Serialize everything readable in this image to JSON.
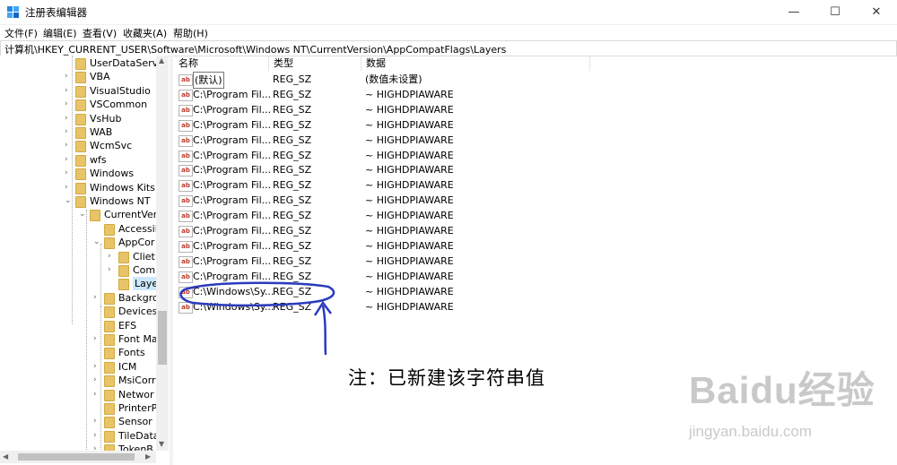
{
  "window": {
    "title": "注册表编辑器",
    "min_glyph": "—",
    "max_glyph": "☐",
    "close_glyph": "✕"
  },
  "menu": [
    "文件(F)",
    "编辑(E)",
    "查看(V)",
    "收藏夹(A)",
    "帮助(H)"
  ],
  "address": "计算机\\HKEY_CURRENT_USER\\Software\\Microsoft\\Windows NT\\CurrentVersion\\AppCompatFlags\\Layers",
  "tree": [
    {
      "label": "UserDataServi"
    },
    {
      "label": "VBA"
    },
    {
      "label": "VisualStudio"
    },
    {
      "label": "VSCommon"
    },
    {
      "label": "VsHub"
    },
    {
      "label": "WAB"
    },
    {
      "label": "WcmSvc"
    },
    {
      "label": "wfs"
    },
    {
      "label": "Windows"
    },
    {
      "label": "Windows Kits"
    },
    {
      "label": "Windows NT"
    },
    {
      "label": "CurrentVer"
    },
    {
      "label": "Accessil"
    },
    {
      "label": "AppCor"
    },
    {
      "label": "Cliet"
    },
    {
      "label": "Com"
    },
    {
      "label": "Laye"
    },
    {
      "label": "Backgro"
    },
    {
      "label": "Devices"
    },
    {
      "label": "EFS"
    },
    {
      "label": "Font Ma"
    },
    {
      "label": "Fonts"
    },
    {
      "label": "ICM"
    },
    {
      "label": "MsiCorr"
    },
    {
      "label": "Networ"
    },
    {
      "label": "PrinterP"
    },
    {
      "label": "Sensor"
    },
    {
      "label": "TileData"
    },
    {
      "label": "TokenB"
    }
  ],
  "columns": [
    "名称",
    "类型",
    "数据"
  ],
  "rows": [
    {
      "name": "(默认)",
      "type": "REG_SZ",
      "data": "(数值未设置)"
    },
    {
      "name": "C:\\Program Fil...",
      "type": "REG_SZ",
      "data": "~ HIGHDPIAWARE"
    },
    {
      "name": "C:\\Program Fil...",
      "type": "REG_SZ",
      "data": "~ HIGHDPIAWARE"
    },
    {
      "name": "C:\\Program Fil...",
      "type": "REG_SZ",
      "data": "~ HIGHDPIAWARE"
    },
    {
      "name": "C:\\Program Fil...",
      "type": "REG_SZ",
      "data": "~ HIGHDPIAWARE"
    },
    {
      "name": "C:\\Program Fil...",
      "type": "REG_SZ",
      "data": "~ HIGHDPIAWARE"
    },
    {
      "name": "C:\\Program Fil...",
      "type": "REG_SZ",
      "data": "~ HIGHDPIAWARE"
    },
    {
      "name": "C:\\Program Fil...",
      "type": "REG_SZ",
      "data": "~ HIGHDPIAWARE"
    },
    {
      "name": "C:\\Program Fil...",
      "type": "REG_SZ",
      "data": "~ HIGHDPIAWARE"
    },
    {
      "name": "C:\\Program Fil...",
      "type": "REG_SZ",
      "data": "~ HIGHDPIAWARE"
    },
    {
      "name": "C:\\Program Fil...",
      "type": "REG_SZ",
      "data": "~ HIGHDPIAWARE"
    },
    {
      "name": "C:\\Program Fil...",
      "type": "REG_SZ",
      "data": "~ HIGHDPIAWARE"
    },
    {
      "name": "C:\\Program Fil...",
      "type": "REG_SZ",
      "data": "~ HIGHDPIAWARE"
    },
    {
      "name": "C:\\Program Fil...",
      "type": "REG_SZ",
      "data": "~ HIGHDPIAWARE"
    },
    {
      "name": "C:\\Windows\\Sy...",
      "type": "REG_SZ",
      "data": "~ HIGHDPIAWARE"
    },
    {
      "name": "C:\\Windows\\Sy...",
      "type": "REG_SZ",
      "data": "~ HIGHDPIAWARE"
    }
  ],
  "icon_text": "ab",
  "annotation": "注：已新建该字符串值",
  "watermark": {
    "logo": "Baidu经验",
    "url": "jingyan.baidu.com"
  },
  "colors": {
    "annotation": "#2b3bbd",
    "selection": "#cce8ff",
    "folder": "#e8c468"
  }
}
